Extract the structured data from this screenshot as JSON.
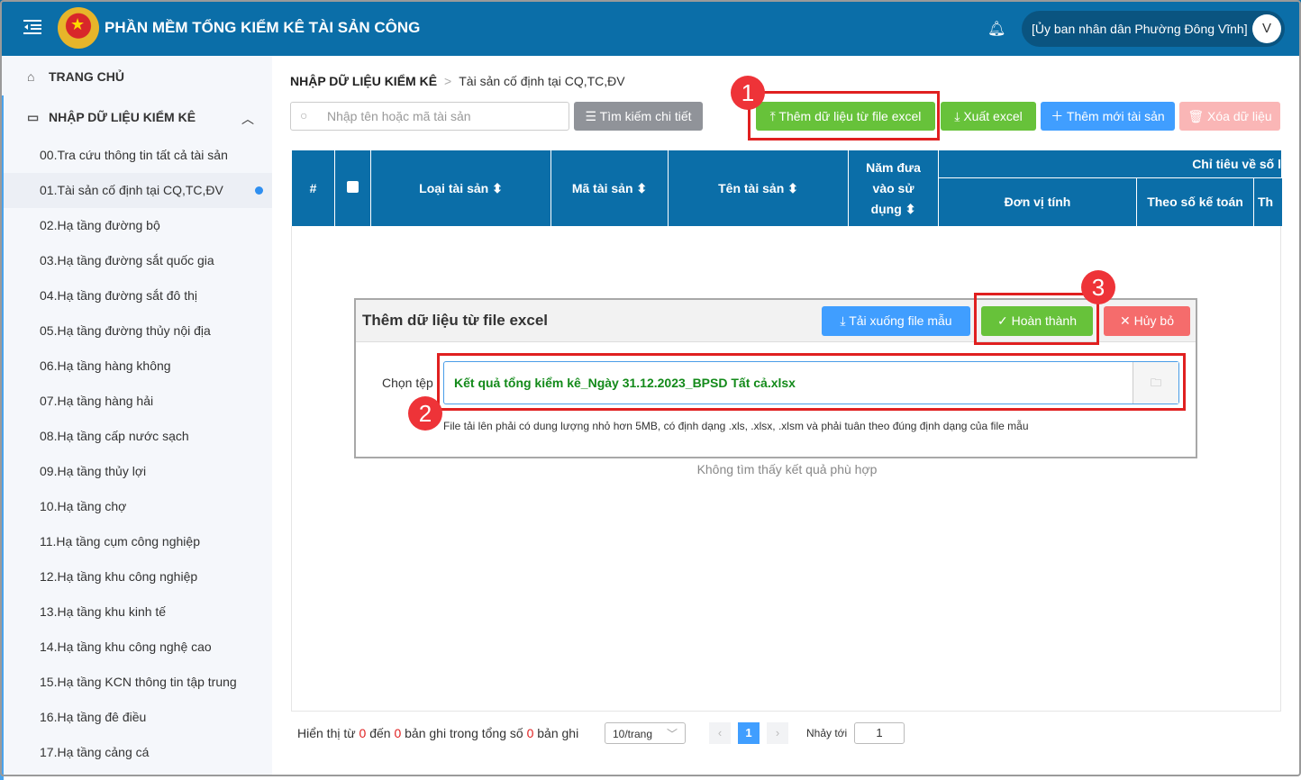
{
  "header": {
    "title": "PHẦN MỀM TỔNG KIỂM KÊ TÀI SẢN CÔNG",
    "user": "[Ủy ban nhân dân Phường Đông Vĩnh]",
    "avatar": "V"
  },
  "sidebar": {
    "home": "TRANG CHỦ",
    "section": "NHẬP DỮ LIỆU KIỂM KÊ",
    "items": [
      "00.Tra cứu thông tin tất cả tài sản",
      "01.Tài sản cố định tại CQ,TC,ĐV",
      "02.Hạ tầng đường bộ",
      "03.Hạ tầng đường sắt quốc gia",
      "04.Hạ tầng đường sắt đô thị",
      "05.Hạ tầng đường thủy nội địa",
      "06.Hạ tầng hàng không",
      "07.Hạ tầng hàng hải",
      "08.Hạ tầng cấp nước sạch",
      "09.Hạ tầng thủy lợi",
      "10.Hạ tầng chợ",
      "11.Hạ tầng cụm công nghiệp",
      "12.Hạ tầng khu công nghiệp",
      "13.Hạ tầng khu kinh tế",
      "14.Hạ tầng khu công nghệ cao",
      "15.Hạ tầng KCN thông tin tập trung",
      "16.Hạ tầng đê điều",
      "17.Hạ tầng cảng cá"
    ]
  },
  "breadcrumb": {
    "root": "NHẬP DỮ LIỆU KIỂM KÊ",
    "current": "Tài sản cố định tại CQ,TC,ĐV"
  },
  "toolbar": {
    "search_placeholder": "Nhập tên hoặc mã tài sản",
    "advanced": "Tìm kiếm chi tiết",
    "import": "Thêm dữ liệu từ file excel",
    "export": "Xuất excel",
    "add": "Thêm mới tài sản",
    "delete": "Xóa dữ liệu"
  },
  "table": {
    "headers": {
      "index": "#",
      "type": "Loại tài sản",
      "code": "Mã tài sản",
      "name": "Tên tài sản",
      "year": "Năm đưa vào sử dụng",
      "group": "Chỉ tiêu về số l",
      "unit": "Đơn vị tính",
      "book": "Theo số kế toán",
      "next": "Th"
    },
    "empty": "Không tìm thấy kết quả phù hợp"
  },
  "modal": {
    "title": "Thêm dữ liệu từ file excel",
    "download": "Tải xuống file mẫu",
    "done": "Hoàn thành",
    "cancel": "Hủy bỏ",
    "label": "Chọn tệp",
    "file": "Kết quả tổng kiểm kê_Ngày 31.12.2023_BPSD Tất cả.xlsx",
    "hint": "File tải lên phải có dung lượng nhỏ hơn 5MB, có định dạng .xls, .xlsx, .xlsm và phải tuân theo đúng định dạng của file mẫu"
  },
  "annotations": [
    "1",
    "2",
    "3"
  ],
  "pagination": {
    "p1": "Hiển thị từ",
    "from": "0",
    "p2": "đến",
    "to": "0",
    "p3": "bản ghi trong tổng số",
    "total": "0",
    "p4": "bản ghi",
    "page_size": "10/trang",
    "page": "1",
    "jump_label": "Nhảy tới",
    "jump_value": "1"
  }
}
